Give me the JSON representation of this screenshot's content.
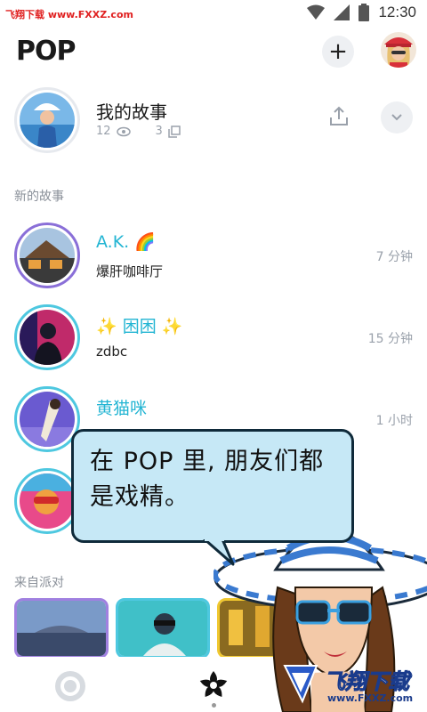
{
  "status_bar": {
    "watermark": "飞翔下载 www.FXXZ.com",
    "time": "12:30"
  },
  "app_bar": {
    "logo": "POP",
    "add_label": "+"
  },
  "my_story": {
    "title": "我的故事",
    "views": "12",
    "snaps": "3"
  },
  "sections": {
    "new_stories": "新的故事",
    "from_party": "来自派对"
  },
  "stories": [
    {
      "name": "A.K. 🌈",
      "subtitle": "爆肝咖啡厅",
      "time": "7 分钟"
    },
    {
      "name": "✨ 困困 ✨",
      "subtitle": "zdbc",
      "time": "15 分钟"
    },
    {
      "name": "黄猫咪",
      "subtitle": "",
      "time": "1 小时"
    },
    {
      "name": "",
      "subtitle": "",
      "time": ""
    }
  ],
  "bubble": {
    "line1": "在 POP 里, 朋友们都",
    "line2": "是戏精。"
  },
  "watermark_bottom": {
    "brand": "飞翔下载",
    "url": "www.FXXZ.com"
  },
  "colors": {
    "accent": "#23b5d3",
    "bubble": "#c6e8f6"
  }
}
